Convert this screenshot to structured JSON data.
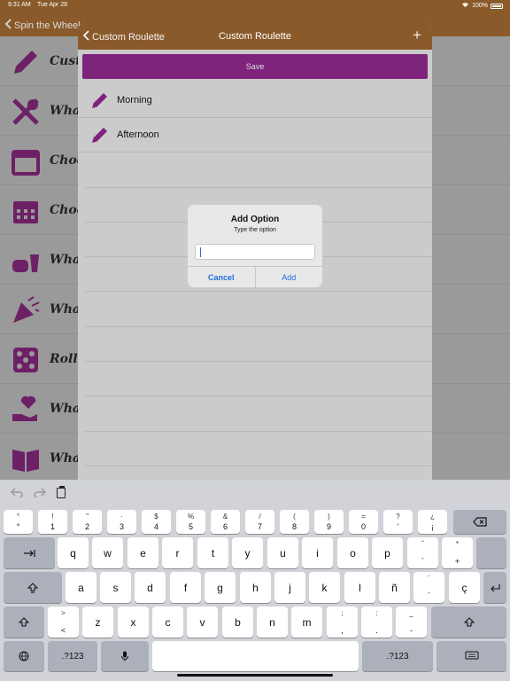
{
  "status": {
    "time": "9:31 AM",
    "date": "Tue Apr 28",
    "battery": "100%"
  },
  "background": {
    "back_label": "Spin the Wheel",
    "rows": [
      {
        "icon": "pencil-icon",
        "text": "Custo"
      },
      {
        "icon": "utensils-icon",
        "text": "What"
      },
      {
        "icon": "calendar-icon",
        "text": "Choos"
      },
      {
        "icon": "calendar-grid-icon",
        "text": "Choos"
      },
      {
        "icon": "fast-food-icon",
        "text": "What"
      },
      {
        "icon": "party-popper-icon",
        "text": "What"
      },
      {
        "icon": "dice-icon",
        "text": "Roll a"
      },
      {
        "icon": "charity-heart-icon",
        "text": "What"
      },
      {
        "icon": "book-icon",
        "text": "What"
      }
    ]
  },
  "sheet": {
    "back_label": "Custom Roulette",
    "title": "Custom Roulette",
    "add_label": "+",
    "save_label": "Save",
    "options": [
      "Morning",
      "Afternoon"
    ],
    "accent": "#8a247f"
  },
  "alert": {
    "title": "Add Option",
    "message": "Type the option",
    "input_value": "",
    "cancel_label": "Cancel",
    "add_label": "Add"
  },
  "keyboard": {
    "row1": [
      {
        "top": "°",
        "bot": "°"
      },
      {
        "top": "!",
        "bot": "1"
      },
      {
        "top": "\"",
        "bot": "2"
      },
      {
        "top": "·",
        "bot": "3"
      },
      {
        "top": "$",
        "bot": "4"
      },
      {
        "top": "%",
        "bot": "5"
      },
      {
        "top": "&",
        "bot": "6"
      },
      {
        "top": "/",
        "bot": "7"
      },
      {
        "top": "(",
        "bot": "8"
      },
      {
        "top": ")",
        "bot": "9"
      },
      {
        "top": "=",
        "bot": "0"
      },
      {
        "top": "?",
        "bot": "'"
      },
      {
        "top": "¿",
        "bot": "¡"
      }
    ],
    "row2": [
      "q",
      "w",
      "e",
      "r",
      "t",
      "y",
      "u",
      "i",
      "o",
      "p"
    ],
    "row2_extra": [
      {
        "top": "ˆ",
        "bot": "`"
      },
      {
        "top": "*",
        "bot": "+"
      }
    ],
    "row3": [
      "a",
      "s",
      "d",
      "f",
      "g",
      "h",
      "j",
      "k",
      "l",
      "ñ"
    ],
    "row3_extra": [
      {
        "top": "¨",
        "bot": "´"
      },
      {
        "top": "",
        "bot": "ç"
      }
    ],
    "row4_first": {
      "top": ">",
      "bot": "<"
    },
    "row4": [
      "z",
      "x",
      "c",
      "v",
      "b",
      "n",
      "m"
    ],
    "row4_extra": [
      {
        "top": ";",
        "bot": ","
      },
      {
        "top": ":",
        "bot": "."
      },
      {
        "top": "_",
        "bot": "-"
      }
    ],
    "numbers_label": ".?123"
  }
}
